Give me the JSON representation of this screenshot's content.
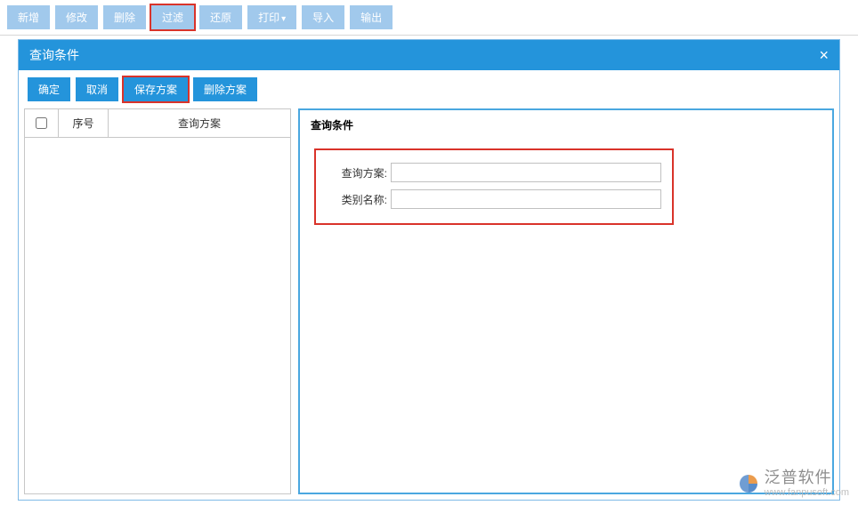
{
  "toolbar": {
    "add": "新增",
    "edit": "修改",
    "delete": "删除",
    "filter": "过滤",
    "restore": "还原",
    "print": "打印",
    "print_arrow": "▾",
    "import": "导入",
    "export": "输出"
  },
  "dialog": {
    "title": "查询条件",
    "close": "×"
  },
  "actions": {
    "ok": "确定",
    "cancel": "取消",
    "save_plan": "保存方案",
    "delete_plan": "删除方案"
  },
  "table": {
    "seq_header": "序号",
    "plan_header": "查询方案"
  },
  "form": {
    "section_title": "查询条件",
    "plan_label": "查询方案:",
    "category_label": "类别名称:",
    "plan_value": "",
    "category_value": ""
  },
  "watermark": {
    "brand": "泛普软件",
    "url": "www.fanpusoft.com"
  }
}
